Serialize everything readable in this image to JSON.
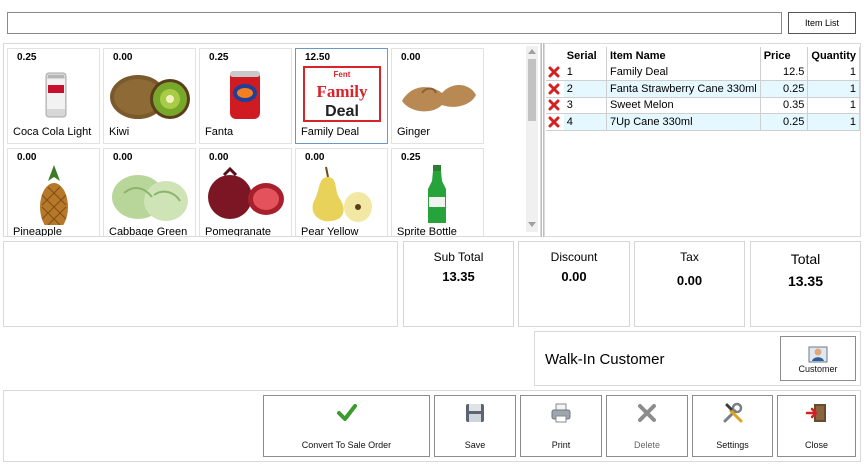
{
  "search": {
    "value": "",
    "placeholder": ""
  },
  "item_list_button": "Item List",
  "products": [
    {
      "price": "0.25",
      "name": "Coca Cola Light",
      "icon": "cola-can-icon"
    },
    {
      "price": "0.00",
      "name": "Kiwi",
      "icon": "kiwi-icon"
    },
    {
      "price": "0.25",
      "name": "Fanta",
      "icon": "fanta-can-icon"
    },
    {
      "price": "12.50",
      "name": "Family Deal",
      "icon": "family-deal-logo"
    },
    {
      "price": "0.00",
      "name": "Ginger",
      "icon": "ginger-icon"
    },
    {
      "price": "0.00",
      "name": "Pineapple",
      "icon": "pineapple-icon"
    },
    {
      "price": "0.00",
      "name": "Cabbage Green",
      "icon": "cabbage-icon"
    },
    {
      "price": "0.00",
      "name": "Pomegranate",
      "icon": "pomegranate-icon"
    },
    {
      "price": "0.00",
      "name": "Pear Yellow",
      "icon": "pear-icon"
    },
    {
      "price": "0.25",
      "name": "Sprite Bottle",
      "icon": "sprite-bottle-icon"
    }
  ],
  "family_deal_logo": {
    "brand": "Fent",
    "line1": "Family",
    "line2": "Deal",
    "brand_color": "#d8232a"
  },
  "order_table": {
    "headers": {
      "serial": "Serial",
      "item_name": "Item Name",
      "price": "Price",
      "quantity": "Quantity"
    },
    "rows": [
      {
        "serial": "1",
        "item_name": "Family Deal",
        "price": "12.5",
        "quantity": "1"
      },
      {
        "serial": "2",
        "item_name": "Fanta Strawberry Cane 330ml",
        "price": "0.25",
        "quantity": "1"
      },
      {
        "serial": "3",
        "item_name": "Sweet Melon",
        "price": "0.35",
        "quantity": "1"
      },
      {
        "serial": "4",
        "item_name": "7Up Cane 330ml",
        "price": "0.25",
        "quantity": "1"
      }
    ]
  },
  "totals": {
    "sub_total": {
      "label": "Sub Total",
      "value": "13.35"
    },
    "discount": {
      "label": "Discount",
      "value": "0.00"
    },
    "tax": {
      "label": "Tax",
      "value": "0.00"
    },
    "total": {
      "label": "Total",
      "value": "13.35"
    }
  },
  "customer": {
    "name": "Walk-In Customer",
    "button_label": "Customer"
  },
  "actions": {
    "convert": "Convert To Sale Order",
    "save": "Save",
    "print": "Print",
    "delete": "Delete",
    "settings": "Settings",
    "close": "Close"
  },
  "colors": {
    "accent": "#6d98c4",
    "row_alt": "#e6f8ff",
    "delete_red": "#d42020",
    "check_green": "#3c9a2e"
  }
}
